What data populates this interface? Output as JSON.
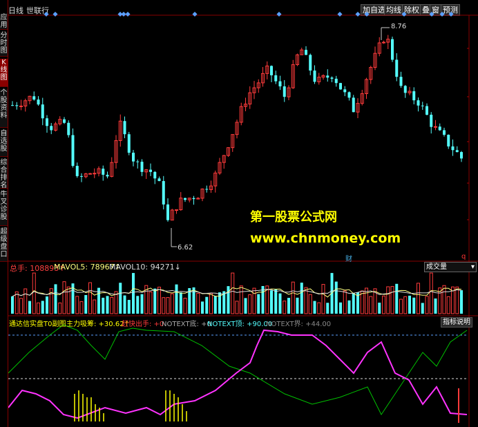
{
  "sidebar": {
    "items": [
      {
        "label": "应用",
        "active": false
      },
      {
        "label": "分时图",
        "active": false
      },
      {
        "label": "K线图",
        "active": true
      },
      {
        "label": "个股资料",
        "active": false
      },
      {
        "label": "自选股",
        "active": false
      },
      {
        "label": "综合排名",
        "active": false
      },
      {
        "label": "牛叉诊股",
        "active": false
      },
      {
        "label": "超级盘口",
        "active": false
      }
    ]
  },
  "header": {
    "period": "日线",
    "stock_name": "世联行",
    "buttons": [
      "加自选",
      "均线",
      "除权",
      "叠",
      "窗",
      "预测"
    ]
  },
  "main_chart": {
    "high_label": "8.76",
    "low_label": "6.62",
    "fin_marker": "财",
    "q_marker": "q"
  },
  "watermark": {
    "line1": "第一股票公式网",
    "line2": "www.chnmoney.com"
  },
  "volume_panel": {
    "total_label": "总手: 108893↑",
    "mavol5_label": "MAVOL5: 78967↑",
    "mavol10_label": "MAVOL10: 94271↓",
    "selector": "成交量"
  },
  "indicator_panel": {
    "title": "通达信实盘T0副图",
    "main_force": "主力吸筹: +30.62↑",
    "rapid_exit": "赶快出手: +0",
    "notext_bottom": "NOTEXT底: +0",
    "notext_top": "NOTEXT顶: +90.00",
    "notext_boundary": "NOTEXT界: +44.00",
    "help_button": "指标说明"
  },
  "colors": {
    "up": "#ff3b3b",
    "down": "#54ffff",
    "magenta": "#ff33ff",
    "yellow": "#ffff00",
    "green": "#00c000"
  }
}
